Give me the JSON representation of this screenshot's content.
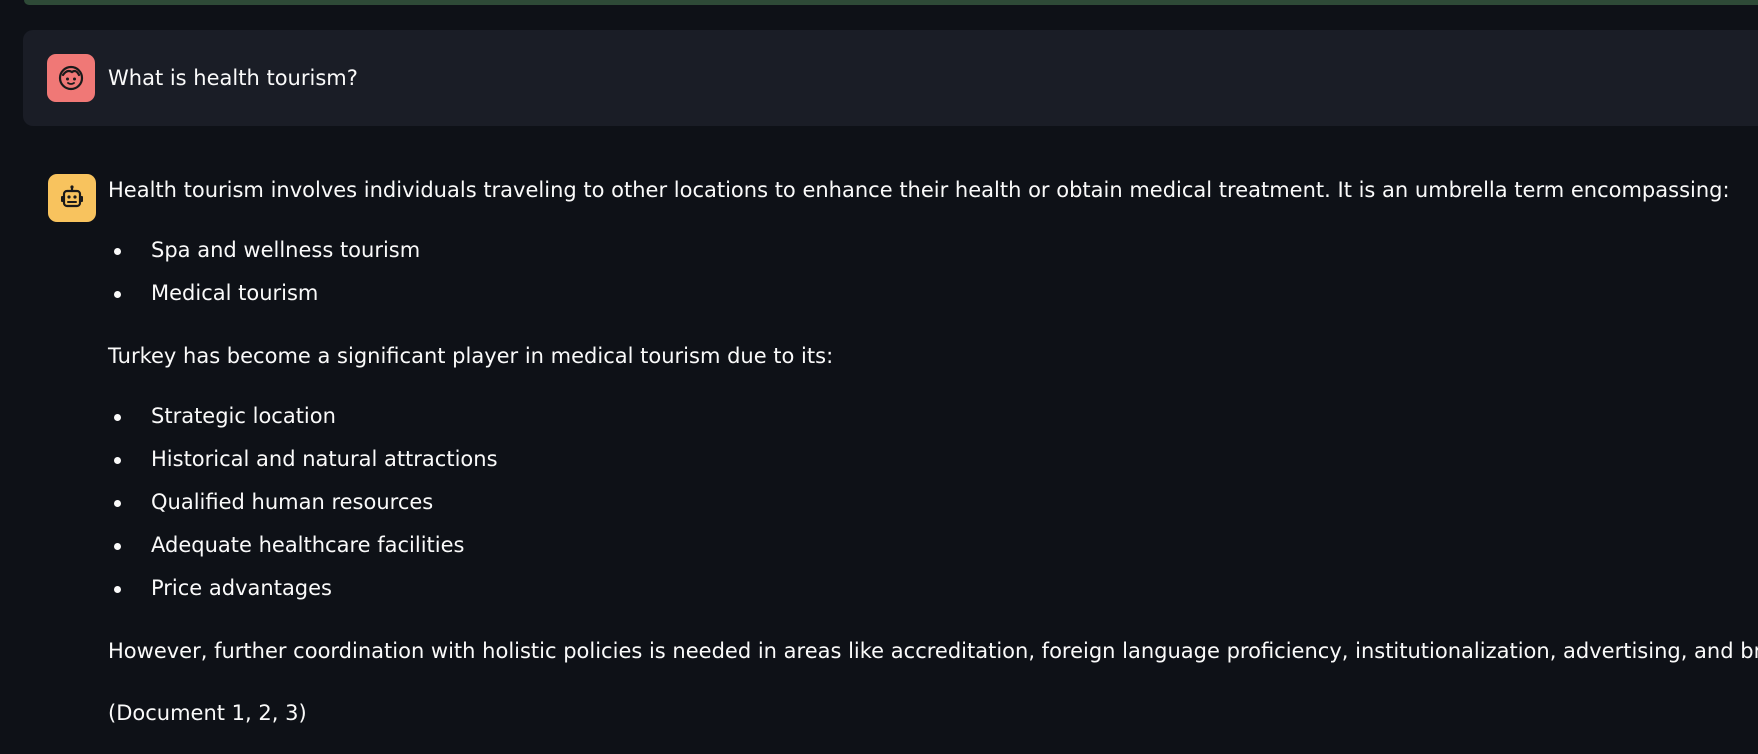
{
  "user_message": {
    "avatar_icon": "user-face-icon",
    "avatar_color": "#f07876",
    "text": "What is health tourism?"
  },
  "assistant_message": {
    "avatar_icon": "robot-icon",
    "avatar_color": "#f8c35e",
    "intro": "Health tourism involves individuals traveling to other locations to enhance their health or obtain medical treatment. It is an umbrella term encompassing:",
    "list1": [
      "Spa and wellness tourism",
      "Medical tourism"
    ],
    "middle": "Turkey has become a significant player in medical tourism due to its:",
    "list2": [
      "Strategic location",
      "Historical and natural attractions",
      "Qualified human resources",
      "Adequate healthcare facilities",
      "Price advantages"
    ],
    "conclusion": "However, further coordination with holistic policies is needed in areas like accreditation, foreign language proficiency, institutionalization, advertising, and branding.",
    "citation": "(Document 1, 2, 3)"
  },
  "colors": {
    "background": "#0e1117",
    "user_bubble": "#1a1d26",
    "top_strip": "#2e4a37",
    "text": "#fafafa"
  }
}
